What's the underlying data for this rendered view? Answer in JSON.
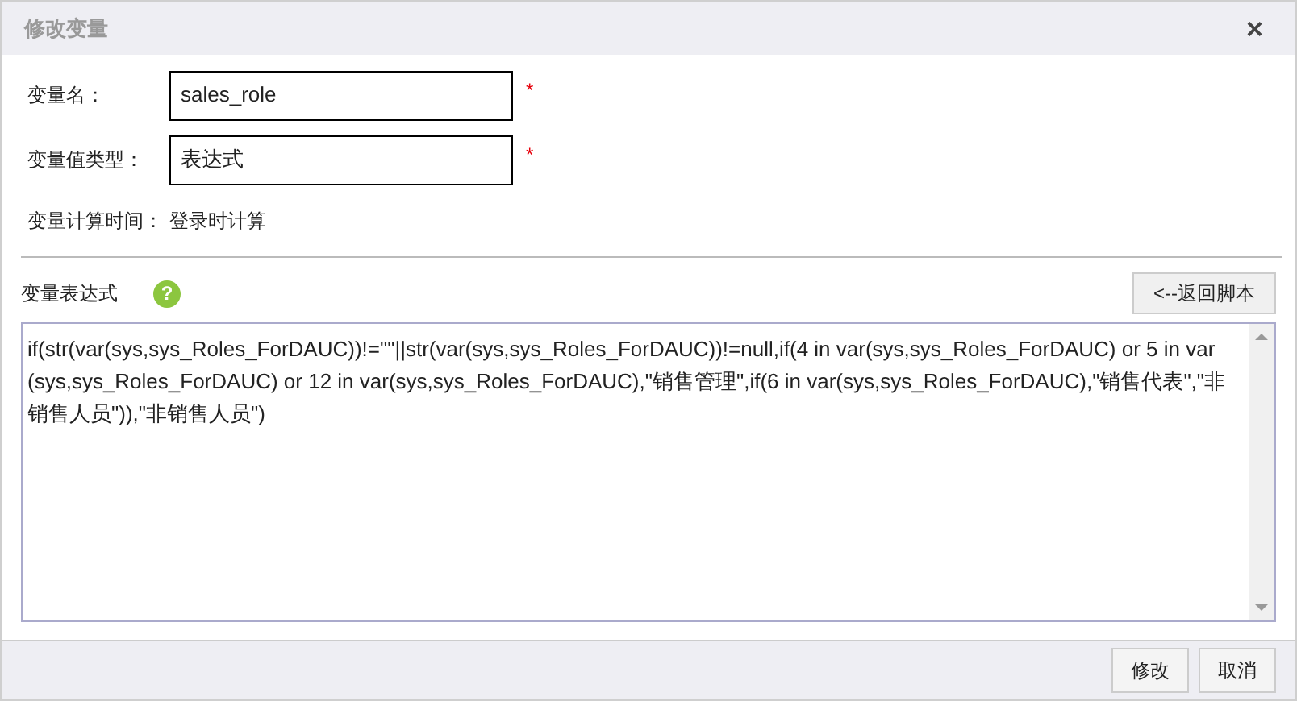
{
  "window": {
    "title": "修改变量",
    "close": "×"
  },
  "fields": [
    {
      "label": "变量名：",
      "value": "sales_role",
      "required_mark": "*"
    },
    {
      "label": "变量值类型：",
      "value": "表达式",
      "required_mark": "*"
    }
  ],
  "calc_time": {
    "label": "变量计算时间：",
    "value": "登录时计算"
  },
  "expression": {
    "label": "变量表达式",
    "help": "?",
    "back_button": "<--返回脚本",
    "value": "if(str(var(sys,sys_Roles_ForDAUC))!=\"\"||str(var(sys,sys_Roles_ForDAUC))!=null,if(4 in var(sys,sys_Roles_ForDAUC) or 5 in var (sys,sys_Roles_ForDAUC) or 12 in var(sys,sys_Roles_ForDAUC),\"销售管理\",if(6 in var(sys,sys_Roles_ForDAUC),\"销售代表\",\"非销售人员\")),\"非销售人员\")"
  },
  "buttons": [
    "修改",
    "取消"
  ]
}
